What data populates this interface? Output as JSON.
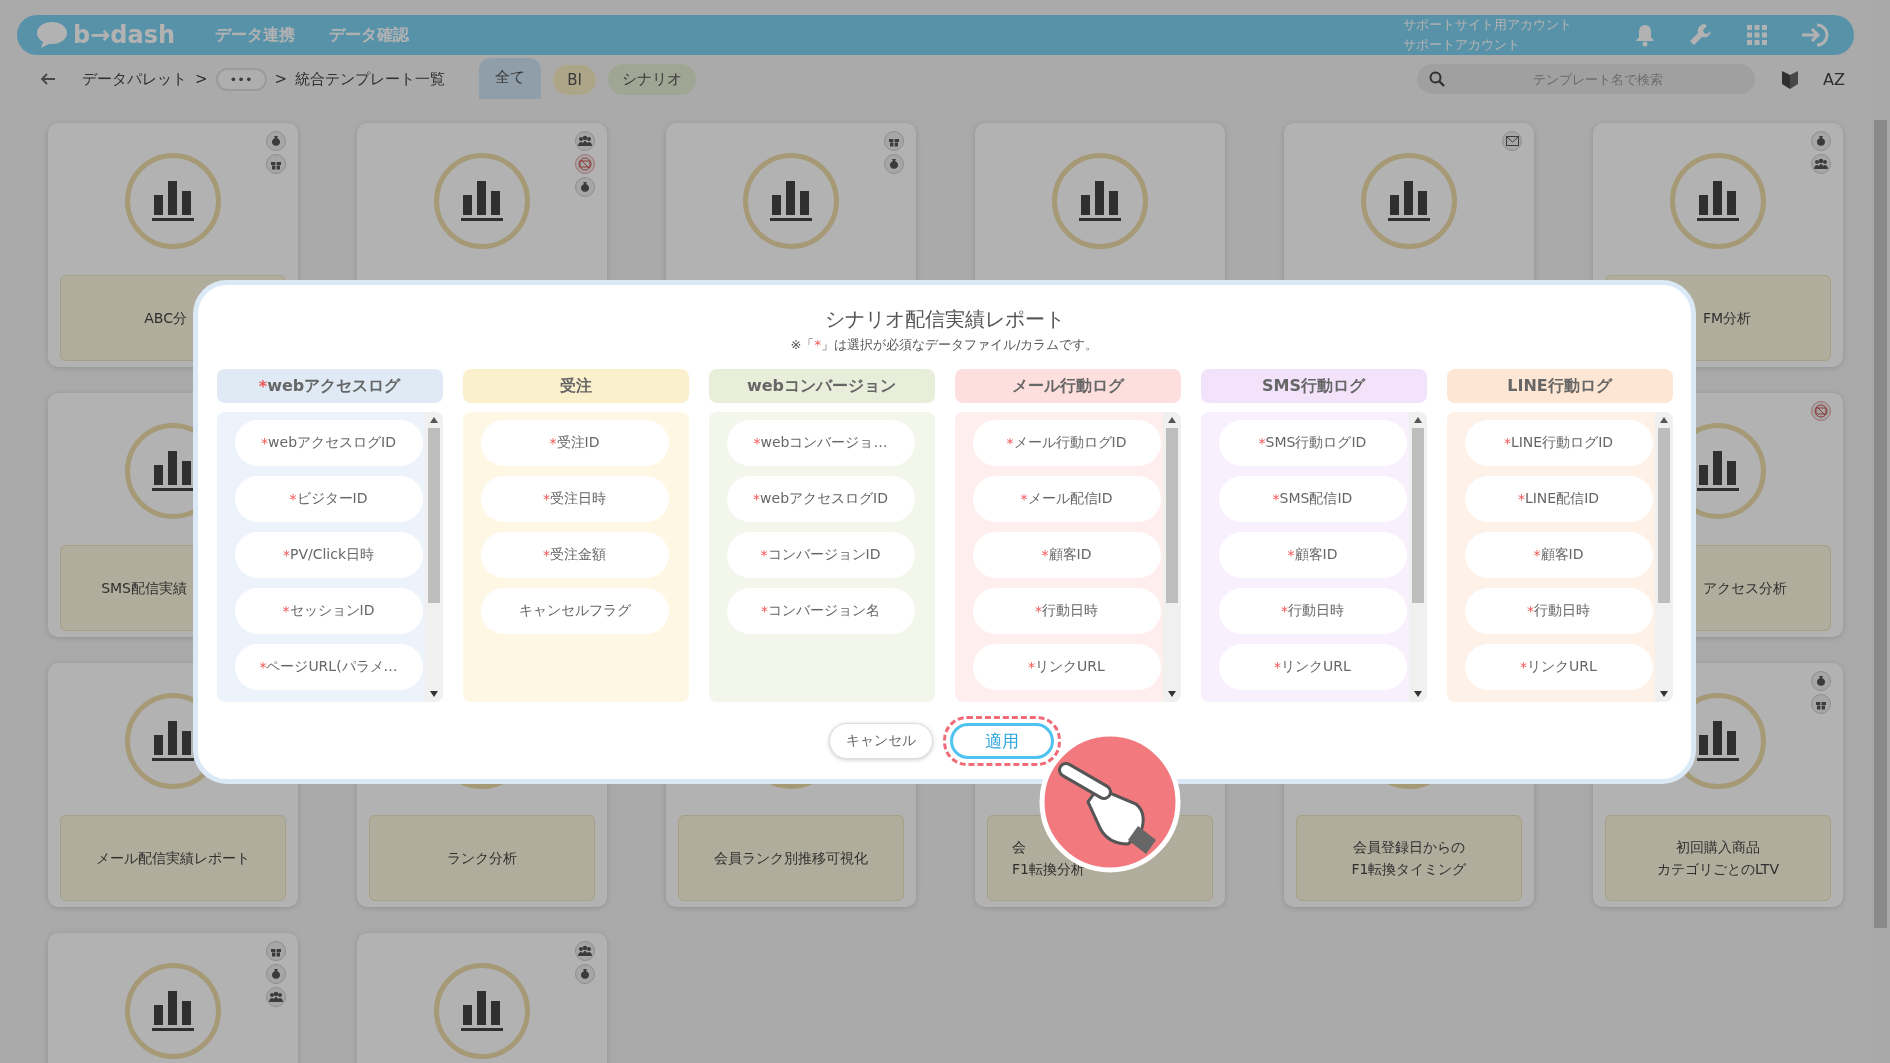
{
  "header": {
    "logo": "b→dash",
    "nav": [
      "データ連携",
      "データ確認"
    ],
    "account_lines": [
      "サポートサイト用アカウント",
      "サポートアカウント"
    ]
  },
  "breadcrumb": [
    {
      "kind": "link",
      "text": "データパレット"
    },
    {
      "kind": "sep",
      "text": ">"
    },
    {
      "kind": "more",
      "text": "•••"
    },
    {
      "kind": "sep",
      "text": ">"
    },
    {
      "kind": "current",
      "text": "統合テンプレート一覧"
    }
  ],
  "filter_tabs": [
    {
      "label": "全て",
      "selected": true
    },
    {
      "label": "BI",
      "selected": false
    },
    {
      "label": "シナリオ",
      "selected": false
    }
  ],
  "search": {
    "placeholder": "テンプレート名で検索"
  },
  "sort_label": "AZ",
  "cards": [
    {
      "kind": "template",
      "label": [
        "ABC分"
      ],
      "badges": [
        {
          "kind": "money"
        },
        {
          "kind": "gift"
        }
      ]
    },
    {
      "kind": "template",
      "badges": [
        {
          "kind": "people"
        },
        {
          "kind": "nocoupon"
        },
        {
          "kind": "money"
        }
      ]
    },
    {
      "kind": "template",
      "badges": [
        {
          "kind": "gift"
        },
        {
          "kind": "money"
        }
      ]
    },
    {
      "kind": "template"
    },
    {
      "kind": "template",
      "badges": [
        {
          "kind": "mail"
        }
      ]
    },
    {
      "kind": "template",
      "label": [
        "FM分析"
      ],
      "badges": [
        {
          "kind": "money"
        },
        {
          "kind": "people"
        }
      ]
    },
    {
      "kind": "template",
      "label": [
        "SMS配信実績"
      ]
    },
    {
      "kind": "template",
      "label": [
        "アクセス分析"
      ],
      "badges": [
        {
          "kind": "nocoupon"
        }
      ]
    },
    {
      "kind": "template",
      "label": [
        "メール配信実績レポート"
      ]
    },
    {
      "kind": "template",
      "label": [
        "ランク分析"
      ]
    },
    {
      "kind": "template",
      "label": [
        "会員ランク別推移可視化"
      ]
    },
    {
      "kind": "template",
      "label": [
        "会",
        "F1転換分析"
      ]
    },
    {
      "kind": "template",
      "label": [
        "会員登録日からの",
        "F1転換タイミング"
      ]
    },
    {
      "kind": "template",
      "label": [
        "初回購入商品",
        "カテゴリごとのLTV"
      ],
      "badges": [
        {
          "kind": "money"
        },
        {
          "kind": "gift"
        }
      ]
    },
    {
      "kind": "template",
      "badges": [
        {
          "kind": "gift"
        },
        {
          "kind": "money"
        },
        {
          "kind": "people"
        }
      ]
    },
    {
      "kind": "template",
      "badges": [
        {
          "kind": "people"
        },
        {
          "kind": "money"
        }
      ]
    }
  ],
  "modal": {
    "title": "シナリオ配信実績レポート",
    "note": {
      "before": "※「",
      "mark": "*",
      "after": "」は選択が必須なデータファイル/カラムです。"
    },
    "columns": [
      {
        "mark": "*",
        "name": "webアクセスログ",
        "color": "#dfeaf5",
        "scrollable": true,
        "items": [
          {
            "mark": "*",
            "text": "webアクセスログID"
          },
          {
            "mark": "*",
            "text": "ビジターID"
          },
          {
            "mark": "*",
            "text": "PV/Click日時"
          },
          {
            "mark": "*",
            "text": "セッションID"
          },
          {
            "mark": "*",
            "text": "ページURL(パラメ…"
          }
        ]
      },
      {
        "name": "受注",
        "color": "#fbf0cc",
        "scrollable": false,
        "items": [
          {
            "mark": "*",
            "text": "受注ID"
          },
          {
            "mark": "*",
            "text": "受注日時"
          },
          {
            "mark": "*",
            "text": "受注金額"
          },
          {
            "text": "キャンセルフラグ"
          }
        ]
      },
      {
        "name": "webコンバージョン",
        "color": "#e9eedb",
        "scrollable": false,
        "items": [
          {
            "mark": "*",
            "text": "webコンバージョ…"
          },
          {
            "mark": "*",
            "text": "webアクセスログID"
          },
          {
            "mark": "*",
            "text": "コンバージョンID"
          },
          {
            "mark": "*",
            "text": "コンバージョン名"
          }
        ]
      },
      {
        "name": "メール行動ログ",
        "color": "#fde0de",
        "scrollable": true,
        "items": [
          {
            "mark": "*",
            "text": "メール行動ログID"
          },
          {
            "mark": "*",
            "text": "メール配信ID"
          },
          {
            "mark": "*",
            "text": "顧客ID"
          },
          {
            "mark": "*",
            "text": "行動日時"
          },
          {
            "mark": "*",
            "text": "リンクURL"
          }
        ]
      },
      {
        "name": "SMS行動ログ",
        "color": "#f2e3fb",
        "scrollable": true,
        "items": [
          {
            "mark": "*",
            "text": "SMS行動ログID"
          },
          {
            "mark": "*",
            "text": "SMS配信ID"
          },
          {
            "mark": "*",
            "text": "顧客ID"
          },
          {
            "mark": "*",
            "text": "行動日時"
          },
          {
            "mark": "*",
            "text": "リンクURL"
          }
        ]
      },
      {
        "name": "LINE行動ログ",
        "color": "#fde6d3",
        "scrollable": true,
        "items": [
          {
            "mark": "*",
            "text": "LINE行動ログID"
          },
          {
            "mark": "*",
            "text": "LINE配信ID"
          },
          {
            "mark": "*",
            "text": "顧客ID"
          },
          {
            "mark": "*",
            "text": "行動日時"
          },
          {
            "mark": "*",
            "text": "リンクURL"
          }
        ]
      }
    ],
    "buttons": [
      {
        "label": "キャンセル",
        "kind": "secondary",
        "highlighted": false
      },
      {
        "label": "適用",
        "kind": "primary",
        "highlighted": true
      }
    ]
  }
}
